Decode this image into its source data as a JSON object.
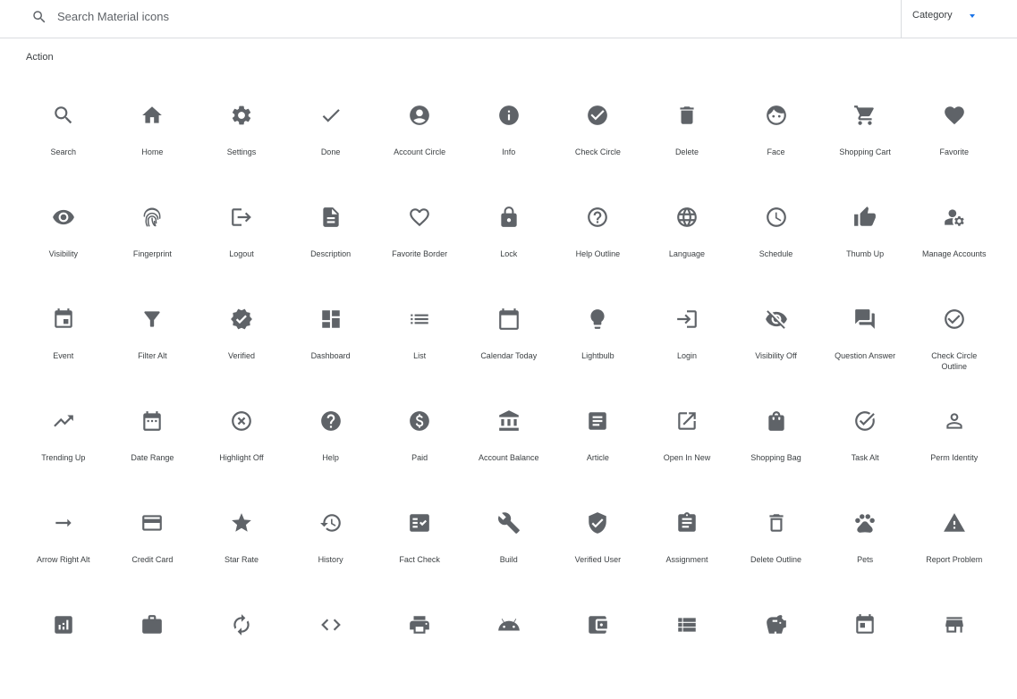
{
  "search": {
    "placeholder": "Search Material icons",
    "value": ""
  },
  "category": {
    "label": "Category"
  },
  "section": {
    "title": "Action"
  },
  "icons": [
    {
      "label": "Search",
      "icon": "search-icon"
    },
    {
      "label": "Home",
      "icon": "home-icon"
    },
    {
      "label": "Settings",
      "icon": "settings-icon"
    },
    {
      "label": "Done",
      "icon": "done-icon"
    },
    {
      "label": "Account Circle",
      "icon": "account-circle-icon"
    },
    {
      "label": "Info",
      "icon": "info-icon"
    },
    {
      "label": "Check Circle",
      "icon": "check-circle-icon"
    },
    {
      "label": "Delete",
      "icon": "delete-icon"
    },
    {
      "label": "Face",
      "icon": "face-icon"
    },
    {
      "label": "Shopping Cart",
      "icon": "shopping-cart-icon"
    },
    {
      "label": "Favorite",
      "icon": "favorite-icon"
    },
    {
      "label": "Visibility",
      "icon": "visibility-icon"
    },
    {
      "label": "Fingerprint",
      "icon": "fingerprint-icon"
    },
    {
      "label": "Logout",
      "icon": "logout-icon"
    },
    {
      "label": "Description",
      "icon": "description-icon"
    },
    {
      "label": "Favorite Border",
      "icon": "favorite-border-icon"
    },
    {
      "label": "Lock",
      "icon": "lock-icon"
    },
    {
      "label": "Help Outline",
      "icon": "help-outline-icon"
    },
    {
      "label": "Language",
      "icon": "language-icon"
    },
    {
      "label": "Schedule",
      "icon": "schedule-icon"
    },
    {
      "label": "Thumb Up",
      "icon": "thumb-up-icon"
    },
    {
      "label": "Manage Accounts",
      "icon": "manage-accounts-icon"
    },
    {
      "label": "Event",
      "icon": "event-icon"
    },
    {
      "label": "Filter Alt",
      "icon": "filter-alt-icon"
    },
    {
      "label": "Verified",
      "icon": "verified-icon"
    },
    {
      "label": "Dashboard",
      "icon": "dashboard-icon"
    },
    {
      "label": "List",
      "icon": "list-icon"
    },
    {
      "label": "Calendar Today",
      "icon": "calendar-today-icon"
    },
    {
      "label": "Lightbulb",
      "icon": "lightbulb-icon"
    },
    {
      "label": "Login",
      "icon": "login-icon"
    },
    {
      "label": "Visibility Off",
      "icon": "visibility-off-icon"
    },
    {
      "label": "Question Answer",
      "icon": "question-answer-icon"
    },
    {
      "label": "Check Circle Outline",
      "icon": "check-circle-outline-icon"
    },
    {
      "label": "Trending Up",
      "icon": "trending-up-icon"
    },
    {
      "label": "Date Range",
      "icon": "date-range-icon"
    },
    {
      "label": "Highlight Off",
      "icon": "highlight-off-icon"
    },
    {
      "label": "Help",
      "icon": "help-icon"
    },
    {
      "label": "Paid",
      "icon": "paid-icon"
    },
    {
      "label": "Account Balance",
      "icon": "account-balance-icon"
    },
    {
      "label": "Article",
      "icon": "article-icon"
    },
    {
      "label": "Open In New",
      "icon": "open-in-new-icon"
    },
    {
      "label": "Shopping Bag",
      "icon": "shopping-bag-icon"
    },
    {
      "label": "Task Alt",
      "icon": "task-alt-icon"
    },
    {
      "label": "Perm Identity",
      "icon": "perm-identity-icon"
    },
    {
      "label": "Arrow Right Alt",
      "icon": "arrow-right-alt-icon"
    },
    {
      "label": "Credit Card",
      "icon": "credit-card-icon"
    },
    {
      "label": "Star Rate",
      "icon": "star-rate-icon"
    },
    {
      "label": "History",
      "icon": "history-icon"
    },
    {
      "label": "Fact Check",
      "icon": "fact-check-icon"
    },
    {
      "label": "Build",
      "icon": "build-icon"
    },
    {
      "label": "Verified User",
      "icon": "verified-user-icon"
    },
    {
      "label": "Assignment",
      "icon": "assignment-icon"
    },
    {
      "label": "Delete Outline",
      "icon": "delete-outline-icon"
    },
    {
      "label": "Pets",
      "icon": "pets-icon"
    },
    {
      "label": "Report Problem",
      "icon": "report-problem-icon"
    },
    {
      "label": "",
      "icon": "analytics-icon"
    },
    {
      "label": "",
      "icon": "work-icon"
    },
    {
      "label": "",
      "icon": "autorenew-icon"
    },
    {
      "label": "",
      "icon": "code-icon"
    },
    {
      "label": "",
      "icon": "print-icon"
    },
    {
      "label": "",
      "icon": "android-icon"
    },
    {
      "label": "",
      "icon": "account-balance-wallet-icon"
    },
    {
      "label": "",
      "icon": "view-list-icon"
    },
    {
      "label": "",
      "icon": "savings-icon"
    },
    {
      "label": "",
      "icon": "today-icon"
    },
    {
      "label": "",
      "icon": "store-icon"
    }
  ],
  "colors": {
    "icon": "#5f6368",
    "text": "#3c4043",
    "accent": "#1a73e8",
    "divider": "#dadce0"
  }
}
